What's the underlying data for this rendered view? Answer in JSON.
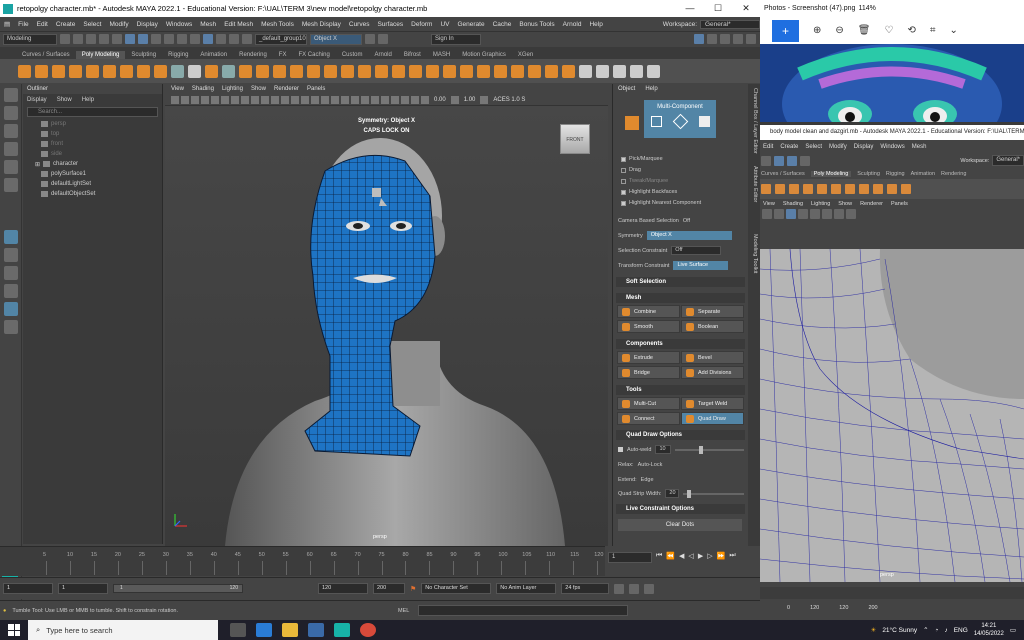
{
  "maya": {
    "title": "retopolgy character.mb* - Autodesk MAYA 2022.1 - Educational Version: F:\\UAL\\TERM 3\\new model\\retopolgy character.mb",
    "menus": [
      "File",
      "Edit",
      "Create",
      "Select",
      "Modify",
      "Display",
      "Windows",
      "Mesh",
      "Edit Mesh",
      "Mesh Tools",
      "Mesh Display",
      "Curves",
      "Surfaces",
      "Deform",
      "UV",
      "Generate",
      "Cache",
      "Bonus Tools",
      "Arnold",
      "Help"
    ],
    "workspace_label": "Workspace:",
    "workspace_value": "General*",
    "mode_dropdown": "Modeling",
    "object_field": "_default_group10",
    "symmetry_field": "Object X",
    "sign_in": "Sign In",
    "shelf_tabs": [
      "Curves / Surfaces",
      "Poly Modeling",
      "Sculpting",
      "Rigging",
      "Animation",
      "Rendering",
      "FX",
      "FX Caching",
      "Custom",
      "Arnold",
      "Bifrost",
      "MASH",
      "Motion Graphics",
      "XGen"
    ],
    "outliner": {
      "title": "Outliner",
      "menu": [
        "Display",
        "Show",
        "Help"
      ],
      "search_placeholder": "Search...",
      "items": [
        "persp",
        "top",
        "front",
        "side",
        "character",
        "polySurface1",
        "defaultLightSet",
        "defaultObjectSet"
      ]
    },
    "viewport": {
      "menu": [
        "View",
        "Shading",
        "Lighting",
        "Show",
        "Renderer",
        "Panels"
      ],
      "exposure": "0.00",
      "gamma": "1.00",
      "colorspace": "ACES 1.0 S",
      "hud_symmetry": "Symmetry: Object X",
      "hud_caps": "CAPS LOCK ON",
      "viewcube_label": "FRONT",
      "camera": "persp"
    },
    "toolkit": {
      "tabs": [
        "Object",
        "Help"
      ],
      "mode": "Multi-Component",
      "pick_options": [
        "Pick/Marquee",
        "Drag",
        "Tweak/Marquee"
      ],
      "highlight_backfaces": "Highlight Backfaces",
      "highlight_nearest": "Highlight Nearest Component",
      "camera_based_label": "Camera Based Selection",
      "camera_based_value": "Off",
      "symmetry_label": "Symmetry",
      "symmetry_value": "Object X",
      "sel_constraint_label": "Selection Constraint",
      "sel_constraint_value": "Off",
      "transform_constraint_label": "Transform Constraint",
      "transform_constraint_value": "Live Surface",
      "soft_selection": "Soft Selection",
      "mesh_section": "Mesh",
      "mesh_tools": [
        "Combine",
        "Separate",
        "Smooth",
        "Boolean"
      ],
      "components_section": "Components",
      "component_tools": [
        "Extrude",
        "Bevel",
        "Bridge",
        "Add Divisions"
      ],
      "tools_section": "Tools",
      "tools": [
        "Multi-Cut",
        "Target Weld",
        "Connect",
        "Quad Draw"
      ],
      "quad_options": "Quad Draw Options",
      "auto_weld_label": "Auto-weld",
      "auto_weld_value": "10",
      "relax_label": "Relax:",
      "relax_value": "Auto-Lock",
      "extend_label": "Extend:",
      "extend_value": "Edge",
      "strip_label": "Quad Strip Width:",
      "strip_value": "20",
      "live_constraint": "Live Constraint Options",
      "clear_dots": "Clear Dots"
    },
    "side_tabs": [
      "Channel Box / Layer Editor",
      "Attribute Editor",
      "Modeling Toolkit"
    ],
    "timeline": {
      "ticks": [
        "5",
        "10",
        "15",
        "20",
        "25",
        "30",
        "35",
        "40",
        "45",
        "50",
        "55",
        "60",
        "65",
        "70",
        "75",
        "80",
        "85",
        "90",
        "95",
        "100",
        "105",
        "110",
        "115",
        "120"
      ],
      "current_frame": "1"
    },
    "range": {
      "start": "1",
      "start_inner": "1",
      "slider_left": "1",
      "slider_right": "120",
      "end_inner": "120",
      "end": "200",
      "character_set": "No Character Set",
      "anim_layer": "No Anim Layer",
      "fps": "24 fps"
    },
    "help_line": "Tumble Tool: Use LMB or MMB to tumble. Shift to constrain rotation.",
    "mel_label": "MEL"
  },
  "photos": {
    "title": "Photos - Screenshot (47).png",
    "zoom": "114%"
  },
  "maya2": {
    "title": "body model clean and dazgirl.mb - Autodesk MAYA 2022.1 - Educational Version: F:\\UAL\\TERM",
    "menus": [
      "Edit",
      "Create",
      "Select",
      "Modify",
      "Display",
      "Windows",
      "Mesh"
    ],
    "workspace_label": "Workspace:",
    "workspace_value": "General*",
    "shelf_tabs": [
      "Curves / Surfaces",
      "Poly Modeling",
      "Sculpting",
      "Rigging",
      "Animation",
      "Rendering"
    ],
    "viewport_menu": [
      "View",
      "Shading",
      "Lighting",
      "Show",
      "Renderer",
      "Panels"
    ],
    "camera": "persp",
    "bottom": [
      "0",
      "120",
      "120",
      "200"
    ]
  },
  "taskbar": {
    "search_placeholder": "Type here to search",
    "weather": "21°C  Sunny",
    "lang": "ENG",
    "time": "14:21",
    "date": "14/05/2022"
  }
}
